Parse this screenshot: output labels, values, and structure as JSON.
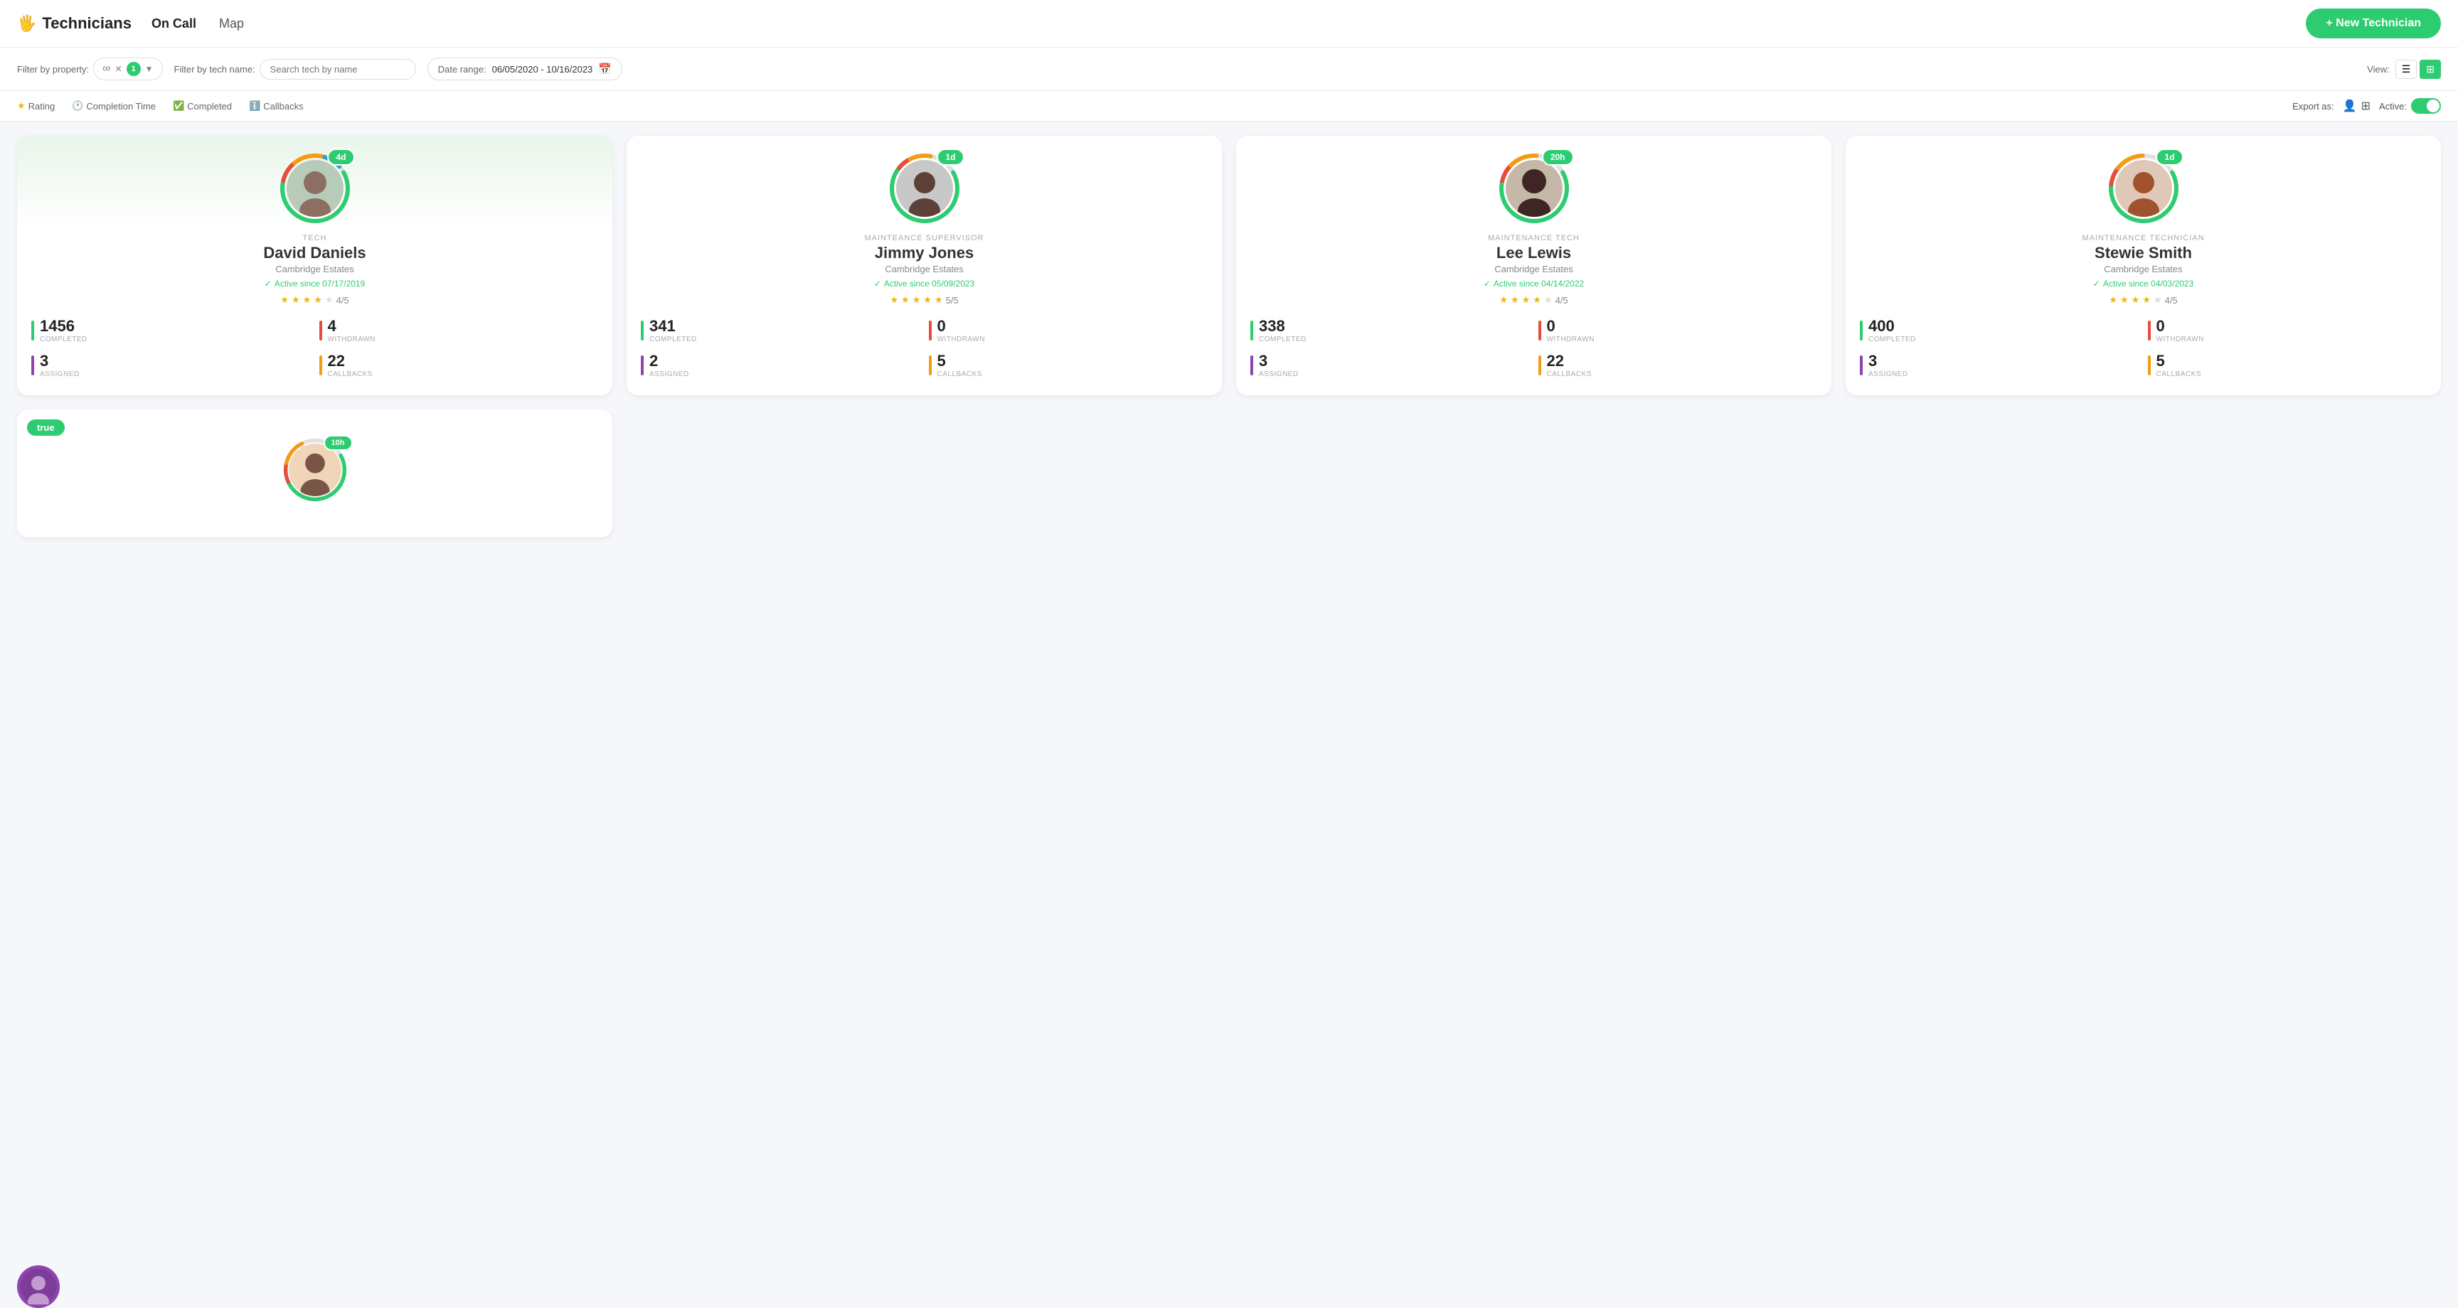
{
  "app": {
    "logo": "🖐️",
    "title": "Technicians",
    "nav": [
      {
        "label": "On Call",
        "active": true
      },
      {
        "label": "Map",
        "active": false
      }
    ],
    "new_tech_btn": "+ New Technician"
  },
  "filters": {
    "property_label": "Filter by property:",
    "property_placeholder": "∞",
    "property_badge": "1",
    "tech_name_label": "Filter by tech name:",
    "tech_name_placeholder": "Search tech by name",
    "date_range_label": "Date range:",
    "date_range_value": "06/05/2020  -  10/16/2023",
    "view_label": "View:"
  },
  "sort": {
    "items": [
      {
        "icon": "⭐",
        "label": "Rating"
      },
      {
        "icon": "🕐",
        "label": "Completion Time"
      },
      {
        "icon": "✅",
        "label": "Completed"
      },
      {
        "icon": "ℹ️",
        "label": "Callbacks"
      }
    ],
    "export_label": "Export as:",
    "active_label": "Active:"
  },
  "technicians": [
    {
      "id": 1,
      "role": "TECH",
      "name": "David Daniels",
      "location": "Cambridge Estates",
      "active_since": "Active since 07/17/2019",
      "rating": 4,
      "rating_text": "4/5",
      "timer": "4d",
      "on_call": false,
      "completed": 1456,
      "withdrawn": 4,
      "assigned": 3,
      "callbacks": 22,
      "ring_colors": [
        "#2ecc71",
        "#e74c3c",
        "#f39c12",
        "#3498db"
      ],
      "avatar_color": "#c8e6c9",
      "avatar_emoji": "👨"
    },
    {
      "id": 2,
      "role": "MAINTEANCE SUPERVISOR",
      "name": "Jimmy Jones",
      "location": "Cambridge Estates",
      "active_since": "Active since 05/09/2023",
      "rating": 5,
      "rating_text": "5/5",
      "timer": "1d",
      "on_call": false,
      "completed": 341,
      "withdrawn": 0,
      "assigned": 2,
      "callbacks": 5,
      "ring_colors": [
        "#2ecc71",
        "#e74c3c",
        "#f39c12",
        "#3498db"
      ],
      "avatar_color": "#e0e0e0",
      "avatar_emoji": "👨"
    },
    {
      "id": 3,
      "role": "MAINTENANCE TECH",
      "name": "Lee Lewis",
      "location": "Cambridge Estates",
      "active_since": "Active since 04/14/2022",
      "rating": 4,
      "rating_text": "4/5",
      "timer": "20h",
      "on_call": false,
      "completed": 338,
      "withdrawn": 0,
      "assigned": 3,
      "callbacks": 22,
      "ring_colors": [
        "#2ecc71",
        "#e74c3c",
        "#f39c12",
        "#3498db"
      ],
      "avatar_color": "#e0e0e0",
      "avatar_emoji": "👨"
    },
    {
      "id": 4,
      "role": "MAINTENANCE TECHNICIAN",
      "name": "Stewie Smith",
      "location": "Cambridge Estates",
      "active_since": "Active since 04/03/2023",
      "rating": 4,
      "rating_text": "4/5",
      "timer": "1d",
      "on_call": false,
      "completed": 400,
      "withdrawn": 0,
      "assigned": 3,
      "callbacks": 5,
      "ring_colors": [
        "#2ecc71",
        "#e74c3c",
        "#f39c12",
        "#3498db"
      ],
      "avatar_color": "#e8d5c4",
      "avatar_emoji": "👨"
    }
  ],
  "bottom_cards": [
    {
      "on_call": true,
      "timer": "10h",
      "avatar_emoji": "👩",
      "avatar_color": "#f3e0c8"
    }
  ]
}
